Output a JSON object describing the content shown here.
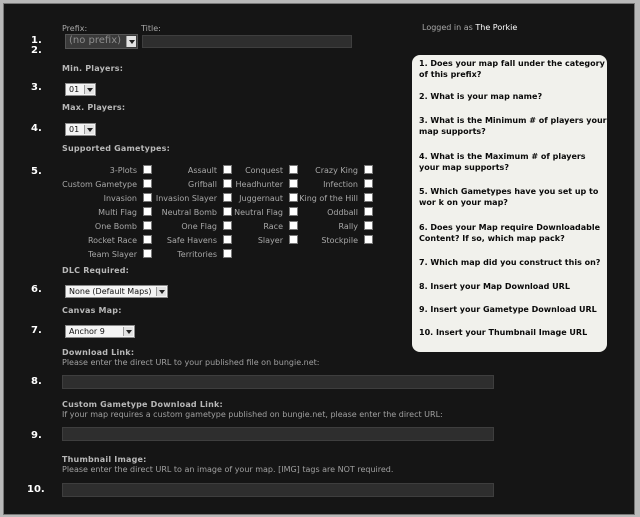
{
  "header": {
    "logged_in_prefix": "Logged in as",
    "username": "The Porkie"
  },
  "fields": {
    "prefix_label": "Prefix:",
    "title_label": "Title:",
    "prefix_value": "(no prefix)",
    "title_value": "",
    "min_players_label": "Min. Players:",
    "min_players_value": "01",
    "max_players_label": "Max. Players:",
    "max_players_value": "01",
    "gametypes_label": "Supported Gametypes:",
    "dlc_label": "DLC Required:",
    "dlc_value": "None (Default Maps)",
    "canvas_label": "Canvas Map:",
    "canvas_value": "Anchor 9",
    "download_label": "Download Link:",
    "download_help": "Please enter the direct URL to your published file on bungie.net:",
    "download_value": "",
    "custom_gt_label": "Custom Gametype Download Link:",
    "custom_gt_help": "If your map requires a custom gametype published on bungie.net, please enter the direct URL:",
    "custom_gt_value": "",
    "thumb_label": "Thumbnail Image:",
    "thumb_help": "Please enter the direct URL to an image of your map. [IMG] tags are NOT required.",
    "thumb_value": ""
  },
  "numbers": [
    "1.",
    "2.",
    "3.",
    "4.",
    "5.",
    "6.",
    "7.",
    "8.",
    "9.",
    "10."
  ],
  "gametypes": [
    [
      "3-Plots",
      "Assault",
      "Conquest",
      "Crazy King"
    ],
    [
      "Custom Gametype",
      "Grifball",
      "Headhunter",
      "Infection"
    ],
    [
      "Invasion",
      "Invasion Slayer",
      "Juggernaut",
      "King of the Hill"
    ],
    [
      "Multi Flag",
      "Neutral Bomb",
      "Neutral Flag",
      "Oddball"
    ],
    [
      "One Bomb",
      "One Flag",
      "Race",
      "Rally"
    ],
    [
      "Rocket Race",
      "Safe Havens",
      "Slayer",
      "Stockpile"
    ],
    [
      "Team Slayer",
      "Territories"
    ]
  ],
  "questions": [
    "1. Does your map fall under the category of this prefix?",
    "2. What is your map name?",
    "3. What is the Minimum # of players your map supports?",
    "4. What is the Maximum # of players your map supports?",
    "5. Which Gametypes have you set up to wor k on your map?",
    "6. Does your Map require Downloadable Content? If so, which map pack?",
    "7. Which map did you construct this on?",
    "8. Insert your Map Download URL",
    "9. Insert your Gametype Download URL",
    "10. Insert your Thumbnail Image URL"
  ]
}
